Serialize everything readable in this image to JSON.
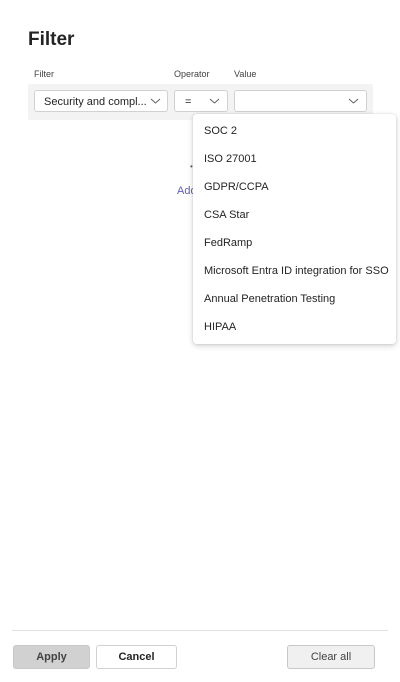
{
  "panel": {
    "title": "Filter"
  },
  "columns": {
    "filter": "Filter",
    "operator": "Operator",
    "value": "Value"
  },
  "row": {
    "filter_value": "Security and compl...",
    "operator_value": "=",
    "value_value": ""
  },
  "dropdown": {
    "options": [
      "SOC 2",
      "ISO 27001",
      "GDPR/CCPA",
      "CSA Star",
      "FedRamp",
      "Microsoft Entra ID integration for SSO",
      "Annual Penetration Testing",
      "HIPAA"
    ]
  },
  "partial": {
    "add_link_fragment": "Add",
    "dot_fragment": "•"
  },
  "footer": {
    "apply": "Apply",
    "cancel": "Cancel",
    "clear_all": "Clear all"
  },
  "colors": {
    "link": "#5b5fc7",
    "text": "#242424",
    "border": "#d1d1d1"
  }
}
